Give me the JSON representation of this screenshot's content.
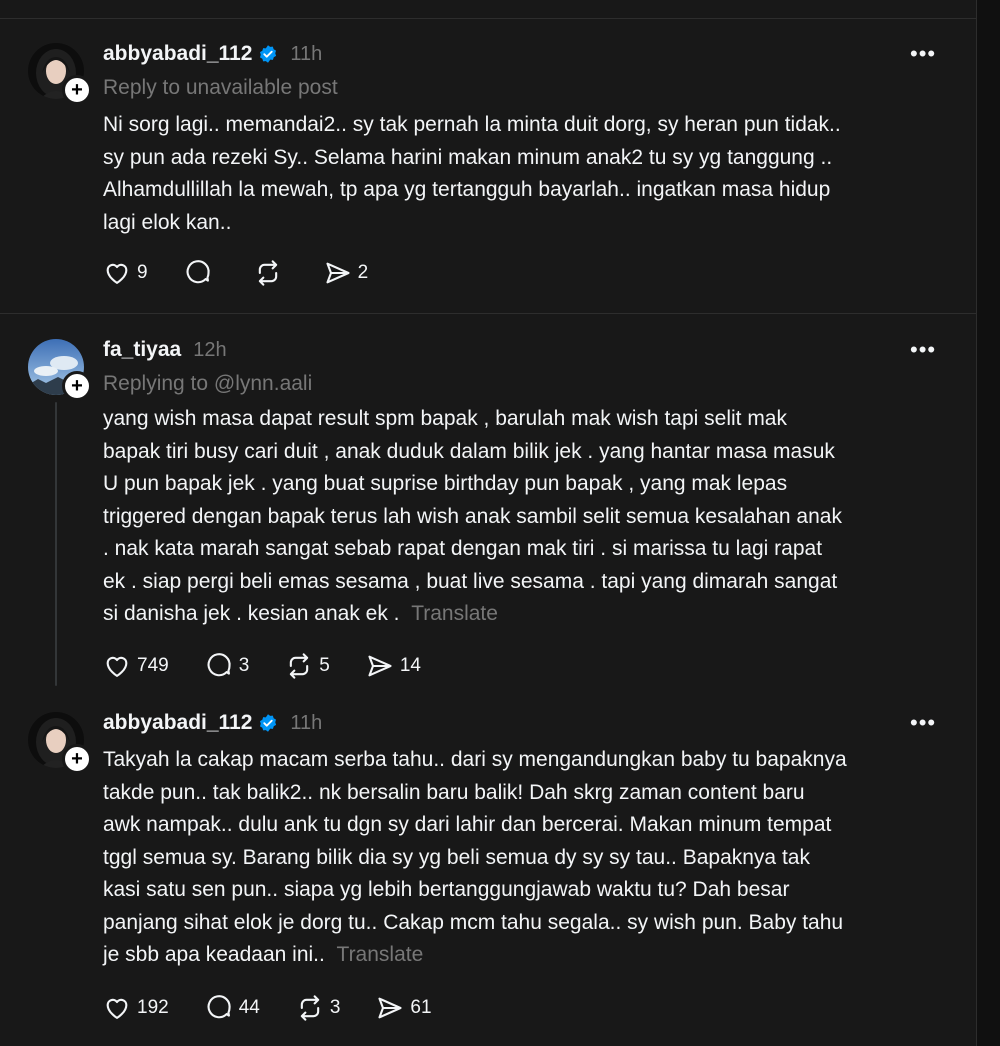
{
  "posts": [
    {
      "username": "abbyabadi_112",
      "time": "11h",
      "reply_to": "Reply to unavailable post",
      "body_lines": [
        "Ni sorg lagi.. memandai2.. sy tak pernah la minta duit dorg, sy heran pun tidak..",
        "sy pun ada rezeki Sy.. Selama harini makan minum anak2 tu sy yg tanggung ..",
        "Alhamdullillah la mewah, tp apa yg tertangguh bayarlah.. ingatkan masa hidup",
        "lagi elok kan.."
      ],
      "translate": "",
      "likes": "9",
      "comments": "",
      "reposts": "",
      "shares": "2"
    },
    {
      "username": "fa_tiyaa",
      "time": "12h",
      "reply_to": "Replying to @lynn.aali",
      "body_lines": [
        "yang wish masa dapat result spm bapak , barulah mak wish tapi selit mak",
        "bapak tiri busy cari duit , anak duduk dalam bilik jek . yang hantar masa masuk",
        "U pun bapak jek . yang buat suprise birthday pun bapak , yang mak lepas",
        "triggered dengan bapak terus lah wish anak sambil selit semua kesalahan anak",
        ". nak kata marah sangat sebab rapat dengan mak tiri . si marissa tu lagi rapat",
        "ek . siap pergi beli emas sesama , buat live sesama . tapi yang dimarah sangat",
        "si danisha jek . kesian anak ek ."
      ],
      "translate": "Translate",
      "likes": "749",
      "comments": "3",
      "reposts": "5",
      "shares": "14"
    },
    {
      "username": "abbyabadi_112",
      "time": "11h",
      "reply_to": "",
      "body_lines": [
        "Takyah la cakap macam serba tahu.. dari sy mengandungkan baby tu bapaknya",
        "takde pun.. tak balik2.. nk bersalin baru balik! Dah skrg zaman content baru",
        "awk nampak.. dulu ank tu dgn sy dari lahir dan bercerai. Makan minum tempat",
        "tggl semua sy. Barang bilik dia sy yg beli semua dy sy sy tau.. Bapaknya tak",
        "kasi satu sen pun.. siapa yg lebih bertanggungjawab waktu tu? Dah besar",
        "panjang sihat elok je dorg tu.. Cakap mcm tahu segala.. sy wish pun. Baby tahu",
        "je sbb apa keadaan ini.."
      ],
      "translate": "Translate",
      "likes": "192",
      "comments": "44",
      "reposts": "3",
      "shares": "61"
    }
  ],
  "icons": {
    "like": "heart-icon",
    "comment": "comment-icon",
    "repost": "repost-icon",
    "share": "share-icon",
    "verified": "verified-badge-icon",
    "more": "more-options-icon",
    "follow": "plus-icon"
  },
  "colors": {
    "background": "#181818",
    "text": "#f3f5f7",
    "muted": "#777777",
    "verified": "#0095f6"
  }
}
